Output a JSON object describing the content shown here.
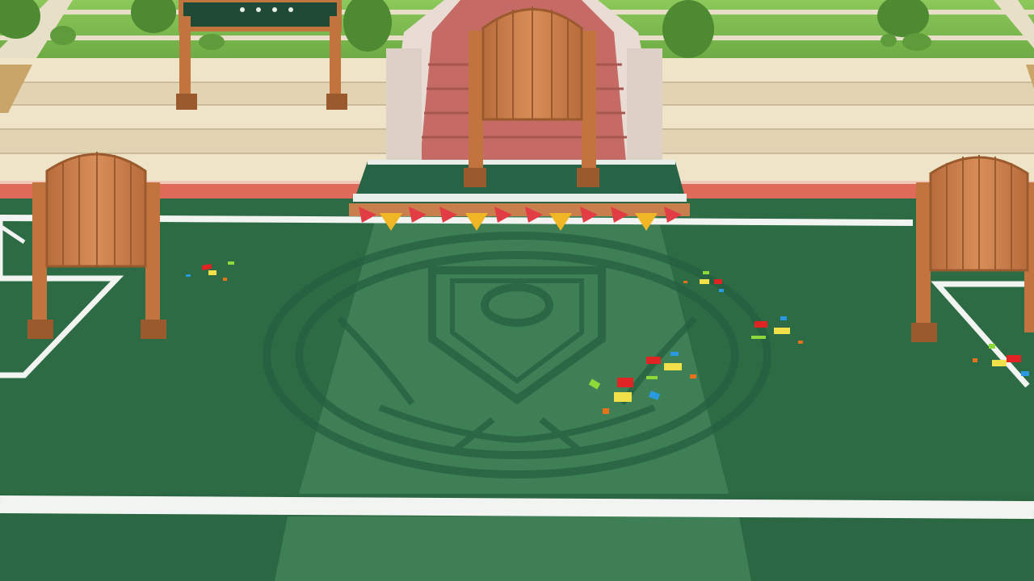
{
  "scene": {
    "palette": {
      "field": "#2c6b44",
      "field_light": "#3d7d55",
      "runway": "#4a8a5e",
      "court_line": "#f2f4f2",
      "track": "#e06a5a",
      "steps": "#e4d6b8",
      "grass": "#79b84a",
      "hedge": "#5e9b3a",
      "wood": "#c97f4c",
      "wood_dark": "#9a5a2e",
      "stair_red": "#c9706a",
      "pillar": "#e8dcd4",
      "board": "#1f4a36"
    },
    "objects": [
      {
        "name": "school-emblem",
        "type": "emblem",
        "text": ""
      },
      {
        "name": "entrance-staircase",
        "type": "staircase",
        "text": ""
      },
      {
        "name": "festival-stage",
        "type": "stage",
        "text": ""
      },
      {
        "name": "bunting-flags",
        "type": "decoration",
        "text": ""
      },
      {
        "name": "wooden-door-gate",
        "type": "gate",
        "text": ""
      },
      {
        "name": "notice-board",
        "type": "board",
        "text": ""
      }
    ]
  }
}
